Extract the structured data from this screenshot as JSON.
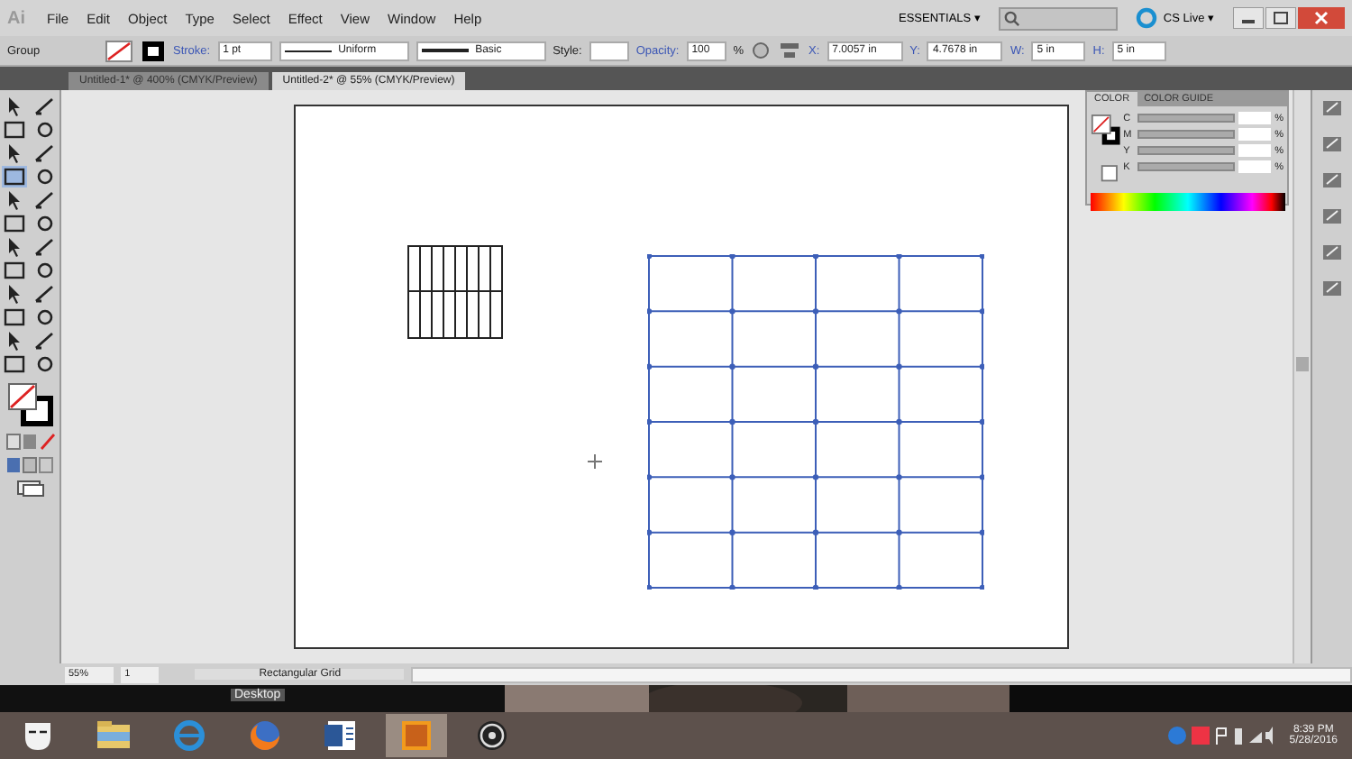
{
  "app_logo": "Ai",
  "menu": [
    "File",
    "Edit",
    "Object",
    "Type",
    "Select",
    "Effect",
    "View",
    "Window",
    "Help"
  ],
  "workspace": "ESSENTIALS ▾",
  "cs_live": "CS Live ▾",
  "control_bar": {
    "selection": "Group",
    "stroke_label": "Stroke:",
    "stroke_weight": "1 pt",
    "profile": "Uniform",
    "brush": "Basic",
    "style_label": "Style:",
    "opacity_label": "Opacity:",
    "opacity": "100",
    "percent": "%",
    "x_label": "X:",
    "x": "7.0057 in",
    "y_label": "Y:",
    "y": "4.7678 in",
    "w_label": "W:",
    "w": "5 in",
    "h_label": "H:",
    "h": "5 in"
  },
  "tabs": [
    {
      "label": "Untitled-1* @ 400% (CMYK/Preview)",
      "selected": false
    },
    {
      "label": "Untitled-2* @ 55% (CMYK/Preview)",
      "selected": true
    }
  ],
  "tools": [
    {
      "selected": false
    },
    {
      "selected": false
    },
    {
      "selected": false
    },
    {
      "selected": false
    },
    {
      "selected": false
    },
    {
      "selected": false
    },
    {
      "selected": true
    },
    {
      "selected": false
    },
    {
      "selected": false
    },
    {
      "selected": false
    },
    {
      "selected": false
    },
    {
      "selected": false
    },
    {
      "selected": false
    },
    {
      "selected": false
    },
    {
      "selected": false
    },
    {
      "selected": false
    },
    {
      "selected": false
    },
    {
      "selected": false
    },
    {
      "selected": false
    },
    {
      "selected": false
    },
    {
      "selected": false
    },
    {
      "selected": false
    },
    {
      "selected": false
    },
    {
      "selected": false
    }
  ],
  "artboard": {
    "objects": [
      {
        "kind": "line-grid",
        "selected": false
      },
      {
        "kind": "rect-grid",
        "selected": true
      }
    ]
  },
  "color_panel": {
    "tabs": [
      {
        "label": "COLOR",
        "selected": true
      },
      {
        "label": "COLOR GUIDE",
        "selected": false
      }
    ],
    "channels": [
      {
        "name": "C",
        "unit": "%"
      },
      {
        "name": "M",
        "unit": "%"
      },
      {
        "name": "Y",
        "unit": "%"
      },
      {
        "name": "K",
        "unit": "%"
      }
    ]
  },
  "status_bar": {
    "zoom": "55%",
    "artboard": "1",
    "tool": "Rectangular Grid"
  },
  "taskbar": {
    "tooltip": "Desktop",
    "apps": [
      {
        "kind": "mask",
        "selected": false
      },
      {
        "kind": "folder",
        "selected": false
      },
      {
        "kind": "browser",
        "selected": false
      },
      {
        "kind": "firefox",
        "selected": false
      },
      {
        "kind": "word",
        "selected": false
      },
      {
        "kind": "illustrator",
        "selected": true
      },
      {
        "kind": "recorder",
        "selected": false
      }
    ],
    "time": "8:39 PM",
    "date": "5/28/2016"
  }
}
